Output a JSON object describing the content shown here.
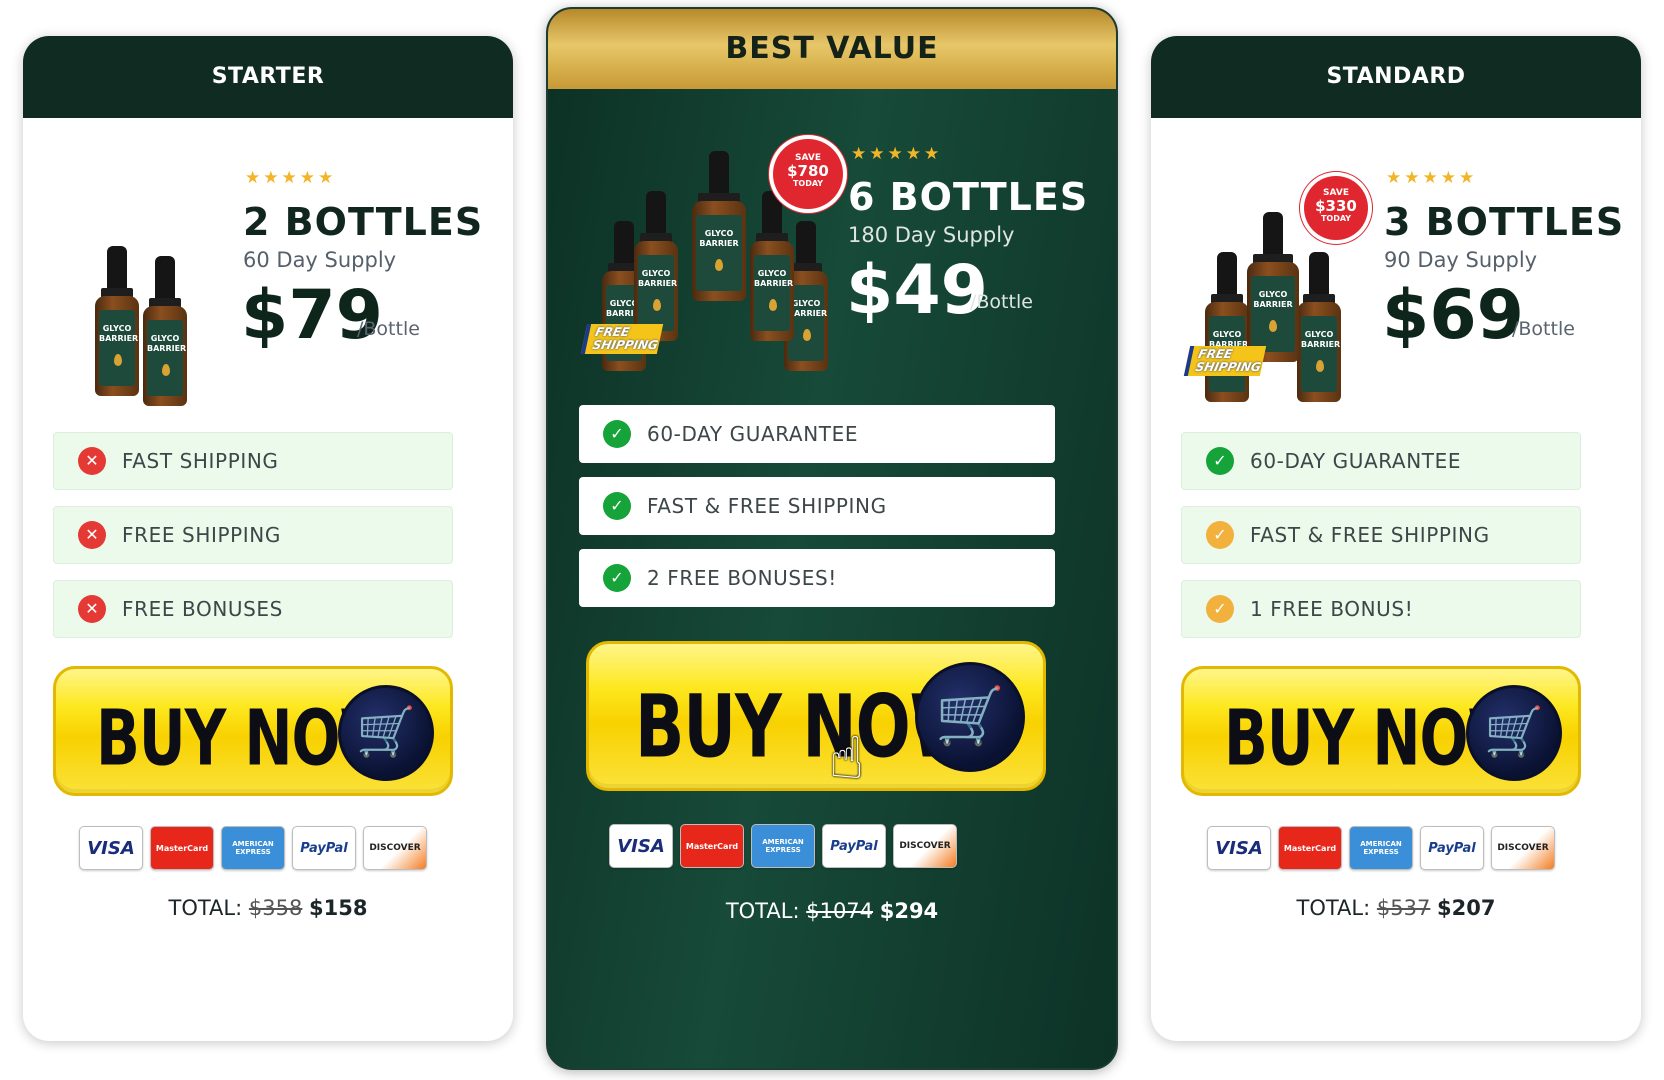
{
  "cards": {
    "starter": {
      "title": "STARTER",
      "rating": "★★★★★",
      "quantity": "2 BOTTLES",
      "supply": "60 Day Supply",
      "price": "$79",
      "per": "/Bottle",
      "features": [
        {
          "status": "x",
          "icon": "close-icon",
          "label": "FAST SHIPPING"
        },
        {
          "status": "x",
          "icon": "close-icon",
          "label": "FREE SHIPPING"
        },
        {
          "status": "x",
          "icon": "close-icon",
          "label": "FREE BONUSES"
        }
      ],
      "buy_label": "BUY NOW",
      "total_label": "TOTAL:",
      "total_old": "$358",
      "total_new": "$158",
      "bottle_brand": "GLYCO BARRIER"
    },
    "best": {
      "title": "BEST VALUE",
      "rating": "★★★★★",
      "quantity": "6 BOTTLES",
      "supply": "180 Day Supply",
      "price": "$49",
      "per": "/Bottle",
      "badge": {
        "top": "SAVE",
        "amount": "$780",
        "bottom": "TODAY"
      },
      "shipping_tag": {
        "line1": "FREE",
        "line2": "SHIPPING"
      },
      "features": [
        {
          "status": "ok",
          "icon": "check-icon",
          "label": "60-DAY GUARANTEE"
        },
        {
          "status": "ok",
          "icon": "check-icon",
          "label": "FAST & FREE SHIPPING"
        },
        {
          "status": "ok",
          "icon": "check-icon",
          "label": "2 FREE BONUSES!"
        }
      ],
      "buy_label": "BUY NOW",
      "total_label": "TOTAL:",
      "total_old": "$1074",
      "total_new": "$294",
      "bottle_brand": "GLYCO BARRIER"
    },
    "standard": {
      "title": "STANDARD",
      "rating": "★★★★★",
      "quantity": "3 BOTTLES",
      "supply": "90 Day Supply",
      "price": "$69",
      "per": "/Bottle",
      "badge": {
        "top": "SAVE",
        "amount": "$330",
        "bottom": "TODAY"
      },
      "shipping_tag": {
        "line1": "FREE",
        "line2": "SHIPPING"
      },
      "features": [
        {
          "status": "ok",
          "icon": "check-icon",
          "label": "60-DAY GUARANTEE"
        },
        {
          "status": "warn",
          "icon": "check-icon",
          "label": "FAST & FREE SHIPPING"
        },
        {
          "status": "warn",
          "icon": "check-icon",
          "label": "1 FREE BONUS!"
        }
      ],
      "buy_label": "BUY NOW",
      "total_label": "TOTAL:",
      "total_old": "$537",
      "total_new": "$207",
      "bottle_brand": "GLYCO BARRIER"
    }
  },
  "payment_methods": {
    "visa": "VISA",
    "mastercard": "MasterCard",
    "amex": "AMERICAN EXPRESS",
    "paypal": "PayPal",
    "discover": "DISCOVER"
  },
  "icons": {
    "cart": "🛒",
    "check": "✓",
    "close": "✕",
    "pointer": "☝"
  },
  "colors": {
    "dark_green": "#0f2b22",
    "gold": "#d6ae4a",
    "buy_yellow": "#fde820",
    "cart_navy": "#0a1232",
    "x_red": "#e53935",
    "check_green": "#15a33a",
    "check_orange": "#f2b03d"
  }
}
